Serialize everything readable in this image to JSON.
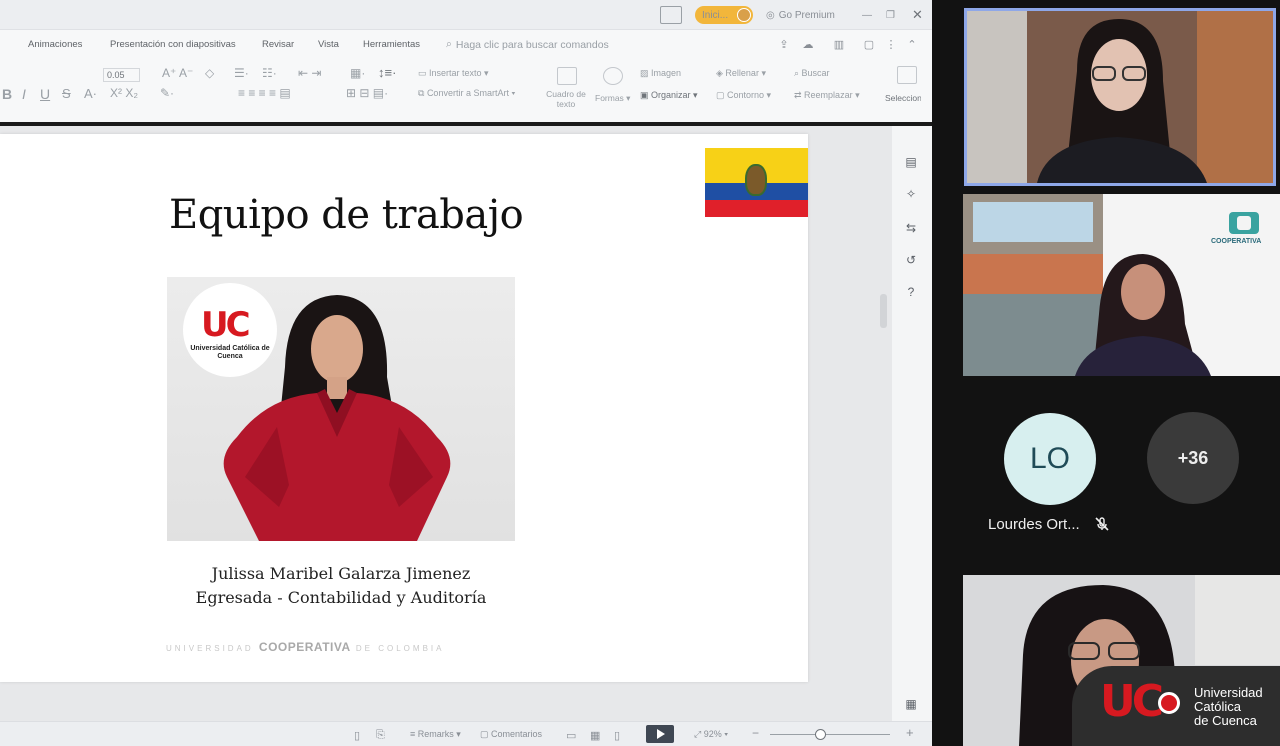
{
  "titlebar": {
    "signin": "Inici...",
    "premium": "Go Premium"
  },
  "menu": {
    "items": [
      "Animaciones",
      "Presentación con diapositivas",
      "Revisar",
      "Vista",
      "Herramientas"
    ],
    "search_placeholder": "Haga clic para buscar comandos"
  },
  "ribbon": {
    "font_size": "0.05",
    "insert_text": "Insertar texto",
    "convert_smartart": "Convertir a SmartArt",
    "text_box": "Cuadro de texto",
    "shapes": "Formas",
    "image": "Imagen",
    "organize": "Organizar",
    "fill": "Rellenar",
    "outline": "Contorno",
    "find": "Buscar",
    "replace": "Reemplazar",
    "select": "Seleccionar"
  },
  "slide": {
    "title": "Equipo de trabajo",
    "logo_text": "Universidad Católica de Cuenca",
    "name": "Julissa Maribel Galarza Jimenez",
    "role": "Egresada - Contabilidad y Auditoría",
    "footer_left": "UNIVERSIDAD",
    "footer_brand": "COOPERATIVA",
    "footer_right": "DE COLOMBIA"
  },
  "statusbar": {
    "notes": "Remarks",
    "comments": "Comentarios",
    "zoom": "92%"
  },
  "participants": {
    "tile2_brand": "COOPERATIVA",
    "avatar_initials": "LO",
    "more_count": "+36",
    "name": "Lourdes Ort..."
  },
  "watermark": {
    "text": "Universidad\nCatólica\nde Cuenca"
  }
}
